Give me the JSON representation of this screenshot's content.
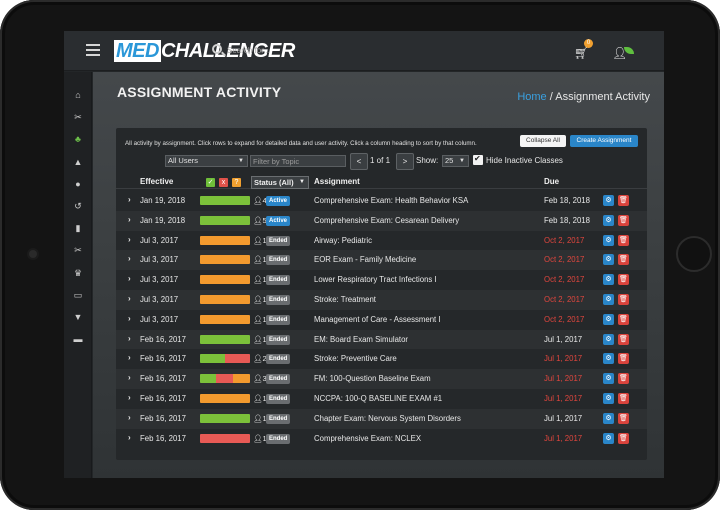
{
  "nav": {
    "logo_part1": "MED",
    "logo_part2": "CHALLENGER",
    "search_placeholder": "Search for...",
    "cart_count": "0",
    "icons": [
      "menu-icon",
      "search-icon",
      "cart-icon",
      "user-icon",
      "leaf-icon"
    ]
  },
  "sidebar": {
    "items": [
      {
        "icon": "home-icon",
        "glyph": "⌂",
        "active": false
      },
      {
        "icon": "tools-icon",
        "glyph": "✂",
        "active": false
      },
      {
        "icon": "users-icon",
        "glyph": "♣",
        "active": true
      },
      {
        "icon": "graduation-icon",
        "glyph": "▲",
        "active": false
      },
      {
        "icon": "person-icon",
        "glyph": "●",
        "active": false
      },
      {
        "icon": "history-icon",
        "glyph": "↺",
        "active": false
      },
      {
        "icon": "book-icon",
        "glyph": "▮",
        "active": false
      },
      {
        "icon": "wrench-icon",
        "glyph": "✂",
        "active": false
      },
      {
        "icon": "trophy-icon",
        "glyph": "♛",
        "active": false
      },
      {
        "icon": "id-card-icon",
        "glyph": "▭",
        "active": false
      },
      {
        "icon": "cart-icon",
        "glyph": "▼",
        "active": false
      },
      {
        "icon": "truck-icon",
        "glyph": "▬",
        "active": false
      }
    ]
  },
  "page": {
    "title": "ASSIGNMENT ACTIVITY",
    "breadcrumb_home": "Home",
    "breadcrumb_sep": "/",
    "breadcrumb_current": "Assignment Activity"
  },
  "panel": {
    "info": "All activity by assignment. Click rows to expand for detailed data and user activity. Click a column heading to sort by that column.",
    "collapse_label": "Collapse All",
    "create_label": "Create Assignment",
    "users_select": "All Users",
    "topic_placeholder": "Filter by Topic",
    "prev_label": "<",
    "next_label": ">",
    "page_text": "1 of 1",
    "show_label": "Show:",
    "page_size": "25",
    "hide_inactive_label": "Hide Inactive Classes",
    "hide_inactive_checked": true
  },
  "columns": {
    "effective": "Effective",
    "status": "Status (All)",
    "assignment": "Assignment",
    "due": "Due",
    "score_icons": [
      {
        "name": "check-icon",
        "glyph": "✓",
        "color": "#6fbf3a"
      },
      {
        "name": "x-icon",
        "glyph": "x",
        "color": "#e0524a"
      },
      {
        "name": "question-icon",
        "glyph": "?",
        "color": "#f0a030"
      }
    ]
  },
  "colors": {
    "green": "#7cc13a",
    "red": "#e85a55",
    "orange": "#f39a2e",
    "due_normal": "#e8e8e8",
    "due_overdue": "#e0463e"
  },
  "rows": [
    {
      "effective": "Jan 19, 2018",
      "bar": [
        [
          "green",
          1
        ]
      ],
      "users": "4",
      "status": "Active",
      "assignment": "Comprehensive Exam: Health Behavior KSA",
      "due": "Feb 18, 2018",
      "overdue": false
    },
    {
      "effective": "Jan 19, 2018",
      "bar": [
        [
          "green",
          1
        ]
      ],
      "users": "5",
      "status": "Active",
      "assignment": "Comprehensive Exam: Cesarean Delivery",
      "due": "Feb 18, 2018",
      "overdue": false
    },
    {
      "effective": "Jul 3, 2017",
      "bar": [
        [
          "orange",
          1
        ]
      ],
      "users": "1",
      "status": "Ended",
      "assignment": "Airway: Pediatric",
      "due": "Oct 2, 2017",
      "overdue": true
    },
    {
      "effective": "Jul 3, 2017",
      "bar": [
        [
          "orange",
          1
        ]
      ],
      "users": "1",
      "status": "Ended",
      "assignment": "EOR Exam - Family Medicine",
      "due": "Oct 2, 2017",
      "overdue": true
    },
    {
      "effective": "Jul 3, 2017",
      "bar": [
        [
          "orange",
          1
        ]
      ],
      "users": "1",
      "status": "Ended",
      "assignment": "Lower Respiratory Tract Infections I",
      "due": "Oct 2, 2017",
      "overdue": true
    },
    {
      "effective": "Jul 3, 2017",
      "bar": [
        [
          "orange",
          1
        ]
      ],
      "users": "1",
      "status": "Ended",
      "assignment": "Stroke: Treatment",
      "due": "Oct 2, 2017",
      "overdue": true
    },
    {
      "effective": "Jul 3, 2017",
      "bar": [
        [
          "orange",
          1
        ]
      ],
      "users": "1",
      "status": "Ended",
      "assignment": "Management of Care - Assessment I",
      "due": "Oct 2, 2017",
      "overdue": true
    },
    {
      "effective": "Feb 16, 2017",
      "bar": [
        [
          "green",
          1
        ]
      ],
      "users": "1",
      "status": "Ended",
      "assignment": "EM: Board Exam Simulator",
      "due": "Jul 1, 2017",
      "overdue": false
    },
    {
      "effective": "Feb 16, 2017",
      "bar": [
        [
          "green",
          0.5
        ],
        [
          "red",
          0.5
        ]
      ],
      "users": "2",
      "status": "Ended",
      "assignment": "Stroke: Preventive Care",
      "due": "Jul 1, 2017",
      "overdue": true
    },
    {
      "effective": "Feb 16, 2017",
      "bar": [
        [
          "green",
          0.32
        ],
        [
          "red",
          0.34
        ],
        [
          "orange",
          0.34
        ]
      ],
      "users": "3",
      "status": "Ended",
      "assignment": "FM: 100-Question Baseline Exam",
      "due": "Jul 1, 2017",
      "overdue": true
    },
    {
      "effective": "Feb 16, 2017",
      "bar": [
        [
          "orange",
          1
        ]
      ],
      "users": "1",
      "status": "Ended",
      "assignment": "NCCPA: 100-Q BASELINE EXAM #1",
      "due": "Jul 1, 2017",
      "overdue": true
    },
    {
      "effective": "Feb 16, 2017",
      "bar": [
        [
          "green",
          1
        ]
      ],
      "users": "1",
      "status": "Ended",
      "assignment": "Chapter Exam: Nervous System Disorders",
      "due": "Jul 1, 2017",
      "overdue": false
    },
    {
      "effective": "Feb 16, 2017",
      "bar": [
        [
          "red",
          1
        ]
      ],
      "users": "1",
      "status": "Ended",
      "assignment": "Comprehensive Exam: NCLEX",
      "due": "Jul 1, 2017",
      "overdue": true
    }
  ]
}
